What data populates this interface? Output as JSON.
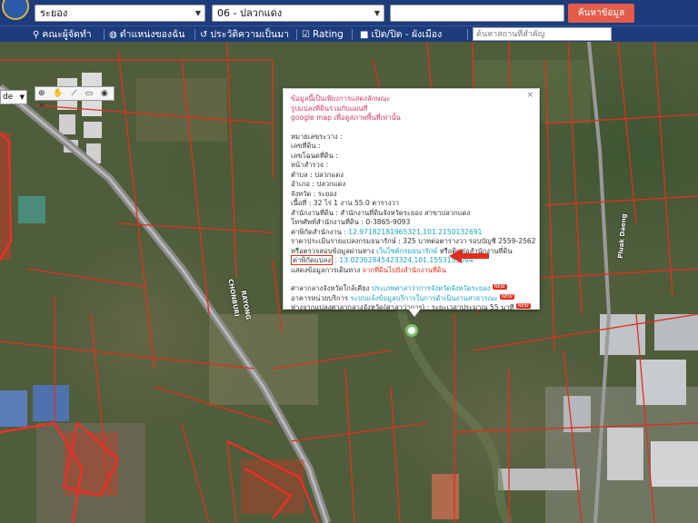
{
  "search": {
    "province": "ระยอง",
    "district": "06 - ปลวกแดง",
    "keyword": "",
    "button": "ค้นหาข้อมูล"
  },
  "menu": {
    "items": [
      {
        "icon": "person-pin-icon",
        "label": "คณะผู้จัดทำ"
      },
      {
        "icon": "globe-icon",
        "label": "ตำแหน่งของฉัน"
      },
      {
        "icon": "history-icon",
        "label": "ประวัติความเป็นมา"
      },
      {
        "icon": "check-square-icon",
        "label": "Rating"
      },
      {
        "icon": "square-icon",
        "label": "เปิด/ปิด - ผังเมือง"
      }
    ],
    "search_placeholder": "ค้นหาสถานที่สำคัญ"
  },
  "map": {
    "lang": "de",
    "tools": "⊕ ✋ ⟋ ▭ ◉ ✕",
    "road_labels": [
      "CHONBURI",
      "RAYONG",
      "Pluak Daeng"
    ]
  },
  "popup": {
    "notice": [
      "ข้อมูลนี้เป็นเพียงการแสดงลักษณะ",
      "รูปแปลงที่ดินร่วมกับแผนที่",
      "google map เพื่อดูสภาพพื้นที่เท่านั้น"
    ],
    "fields": [
      {
        "label": "หมายเลขระวาง",
        "value": ":"
      },
      {
        "label": "เลขที่ดิน",
        "value": ":"
      },
      {
        "label": "เลขโฉนดที่ดิน",
        "value": ":"
      },
      {
        "label": "หน้าสำรวจ",
        "value": ":"
      },
      {
        "label": "ตำบล",
        "value": ": ปลวกแดง"
      },
      {
        "label": "อำเภอ",
        "value": ": ปลวกแดง"
      },
      {
        "label": "จังหวัด",
        "value": ": ระยอง"
      },
      {
        "label": "เนื้อที่",
        "value": ": 32 ไร่ 1 งาน 55.0 ตารางวา"
      },
      {
        "label": "สำนักงานที่ดิน",
        "value": ": สำนักงานที่ดินจังหวัดระยอง สาขาปลวกแดง"
      },
      {
        "label": "โทรศัพท์สำนักงานที่ดิน",
        "value": ": 0-3865-9093"
      }
    ],
    "office_coord": {
      "label": "ค่าพิกัดสำนักงาน",
      "value": ": 12.97182181965321,101.2150132691"
    },
    "appraisal": {
      "label": "ราคาประเมินรายแปลงกรมธนารักษ์",
      "value": ": 325 บาทต่อตารางวา รอบบัญชี 2559-2562"
    },
    "treasury_check": {
      "prefix": "หรือตรวจสอบข้อมูลผ่านทาง",
      "link": "เว็บไซต์กรมธนารักษ์",
      "suffix": "หรือติดต่อสำนักงานที่ดิน"
    },
    "parcel_coord": {
      "label": "ค่าพิกัดแปลง",
      "value": ": 13.02362845423324,101.1553155094"
    },
    "steps": {
      "prefix": "แสดงข้อมูลการเดินทาง",
      "link": "จากที่ดินไปยังสำนักงานที่ดิน"
    },
    "provincial_hall": {
      "label": "ศาลากลางจังหวัดใกล้เคียง",
      "link": "ประเภทศาลาว่าการจังหวัดจังหวัดระยอง",
      "tag": "NEW"
    },
    "public_service": {
      "label": "อาคารหน่วยบริการ",
      "link": "ระบบแจ้งข้อมูลบริการในการดำเนินงานสาธารณะ",
      "tag": "NEW"
    },
    "distance": {
      "label": "ห่างจากแปลงศาลากลางจังหวัด(ศาลาว่าการ)",
      "value": ": ระยะเวลาประมาณ 55 นาที",
      "tag": "NEW"
    },
    "close": "×"
  },
  "colors": {
    "header": "#1d3c7c",
    "search_button": "#e45b4b",
    "parcel_line": "#e0301e",
    "notice_text": "#d6336c",
    "link_text": "#1aa3c7"
  }
}
